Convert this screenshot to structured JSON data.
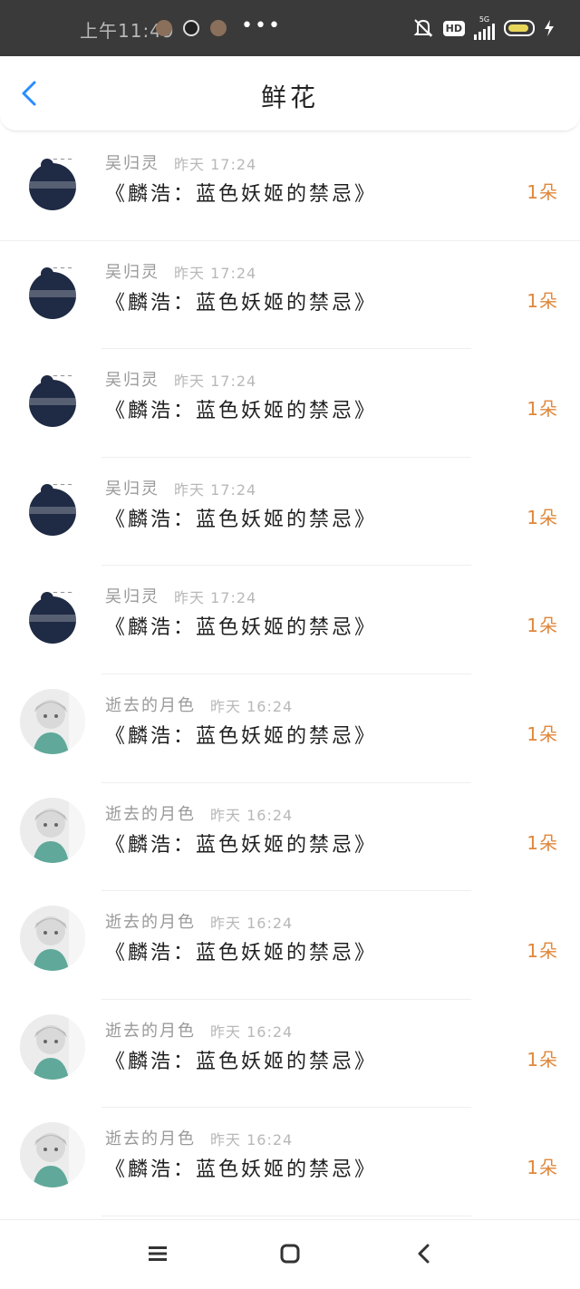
{
  "statusbar": {
    "time": "上午11:49",
    "net": "5G",
    "hd": "HD"
  },
  "header": {
    "title": "鲜花"
  },
  "items": [
    {
      "name": "吴归灵",
      "time": "昨天 17:24",
      "book": "《麟浩：蓝色妖姬的禁忌》",
      "count": "1朵",
      "avatar": "silhouette"
    },
    {
      "name": "吴归灵",
      "time": "昨天 17:24",
      "book": "《麟浩：蓝色妖姬的禁忌》",
      "count": "1朵",
      "avatar": "silhouette"
    },
    {
      "name": "吴归灵",
      "time": "昨天 17:24",
      "book": "《麟浩：蓝色妖姬的禁忌》",
      "count": "1朵",
      "avatar": "silhouette"
    },
    {
      "name": "吴归灵",
      "time": "昨天 17:24",
      "book": "《麟浩：蓝色妖姬的禁忌》",
      "count": "1朵",
      "avatar": "silhouette"
    },
    {
      "name": "吴归灵",
      "time": "昨天 17:24",
      "book": "《麟浩：蓝色妖姬的禁忌》",
      "count": "1朵",
      "avatar": "silhouette"
    },
    {
      "name": "逝去的月色",
      "time": "昨天 16:24",
      "book": "《麟浩：蓝色妖姬的禁忌》",
      "count": "1朵",
      "avatar": "anime"
    },
    {
      "name": "逝去的月色",
      "time": "昨天 16:24",
      "book": "《麟浩：蓝色妖姬的禁忌》",
      "count": "1朵",
      "avatar": "anime"
    },
    {
      "name": "逝去的月色",
      "time": "昨天 16:24",
      "book": "《麟浩：蓝色妖姬的禁忌》",
      "count": "1朵",
      "avatar": "anime"
    },
    {
      "name": "逝去的月色",
      "time": "昨天 16:24",
      "book": "《麟浩：蓝色妖姬的禁忌》",
      "count": "1朵",
      "avatar": "anime"
    },
    {
      "name": "逝去的月色",
      "time": "昨天 16:24",
      "book": "《麟浩：蓝色妖姬的禁忌》",
      "count": "1朵",
      "avatar": "anime"
    }
  ],
  "colors": {
    "accent": "#2a8cff",
    "count": "#e0873a",
    "statusbar": "#3a3a3a"
  },
  "icons": {
    "back": "chevron-left-icon",
    "menu": "menu-icon",
    "home": "home-icon",
    "nav_back": "back-icon"
  }
}
